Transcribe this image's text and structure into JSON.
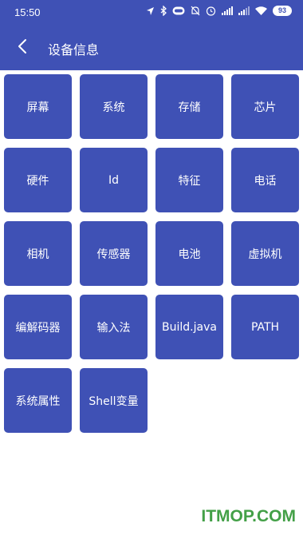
{
  "status_bar": {
    "time": "15:50",
    "battery": "93",
    "icons": [
      "location-icon",
      "bluetooth-icon",
      "vr-icon",
      "mute-icon",
      "alarm-icon",
      "signal-icon",
      "signal-icon-2",
      "wifi-icon",
      "battery-icon"
    ]
  },
  "app_bar": {
    "title": "设备信息",
    "back_icon": "chevron-left-icon"
  },
  "tiles": [
    {
      "label": "屏幕",
      "name": "tile-screen"
    },
    {
      "label": "系统",
      "name": "tile-system"
    },
    {
      "label": "存储",
      "name": "tile-storage"
    },
    {
      "label": "芯片",
      "name": "tile-chip"
    },
    {
      "label": "硬件",
      "name": "tile-hardware"
    },
    {
      "label": "Id",
      "name": "tile-id"
    },
    {
      "label": "特征",
      "name": "tile-features"
    },
    {
      "label": "电话",
      "name": "tile-phone"
    },
    {
      "label": "相机",
      "name": "tile-camera"
    },
    {
      "label": "传感器",
      "name": "tile-sensors"
    },
    {
      "label": "电池",
      "name": "tile-battery"
    },
    {
      "label": "虚拟机",
      "name": "tile-vm"
    },
    {
      "label": "编解码器",
      "name": "tile-codecs"
    },
    {
      "label": "输入法",
      "name": "tile-input-method"
    },
    {
      "label": "Build.java",
      "name": "tile-build-java"
    },
    {
      "label": "PATH",
      "name": "tile-path"
    },
    {
      "label": "系统属性",
      "name": "tile-system-properties"
    },
    {
      "label": "Shell变量",
      "name": "tile-shell-variables"
    }
  ],
  "watermark": "ITMOP.COM",
  "colors": {
    "primary": "#3f51b5",
    "watermark": "#43a047"
  }
}
